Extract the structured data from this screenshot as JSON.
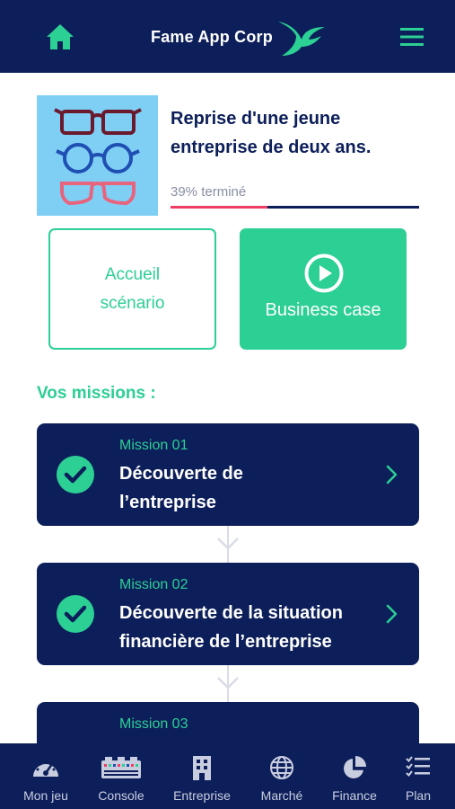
{
  "header": {
    "title": "Fame App Corp"
  },
  "scenario": {
    "title": "Reprise d'une jeune entreprise de deux ans.",
    "progress_label": "39% terminé",
    "progress_fraction": 0.39
  },
  "buttons": {
    "accueil_line1": "Accueil",
    "accueil_line2": "scénario",
    "business": "Business case"
  },
  "missions_heading": "Vos missions :",
  "missions": [
    {
      "number": "Mission 01",
      "title_line1": "Découverte de",
      "title_line2": "l’entreprise"
    },
    {
      "number": "Mission 02",
      "title_line1": "Découverte de la situation",
      "title_line2": "financière de l’entreprise"
    },
    {
      "number": "Mission 03",
      "title_line1": "",
      "title_line2": ""
    }
  ],
  "tabs": [
    {
      "label": "Mon jeu",
      "icon": "gauge-icon"
    },
    {
      "label": "Console",
      "icon": "console-icon"
    },
    {
      "label": "Entreprise",
      "icon": "building-icon"
    },
    {
      "label": "Marché",
      "icon": "globe-icon"
    },
    {
      "label": "Finance",
      "icon": "pie-chart-icon"
    },
    {
      "label": "Plan",
      "icon": "checklist-icon"
    }
  ],
  "colors": {
    "navy": "#0d1f5a",
    "accent_green": "#2ccf94",
    "progress_red": "#ef3e63",
    "thumb_bg": "#7fcff5"
  }
}
